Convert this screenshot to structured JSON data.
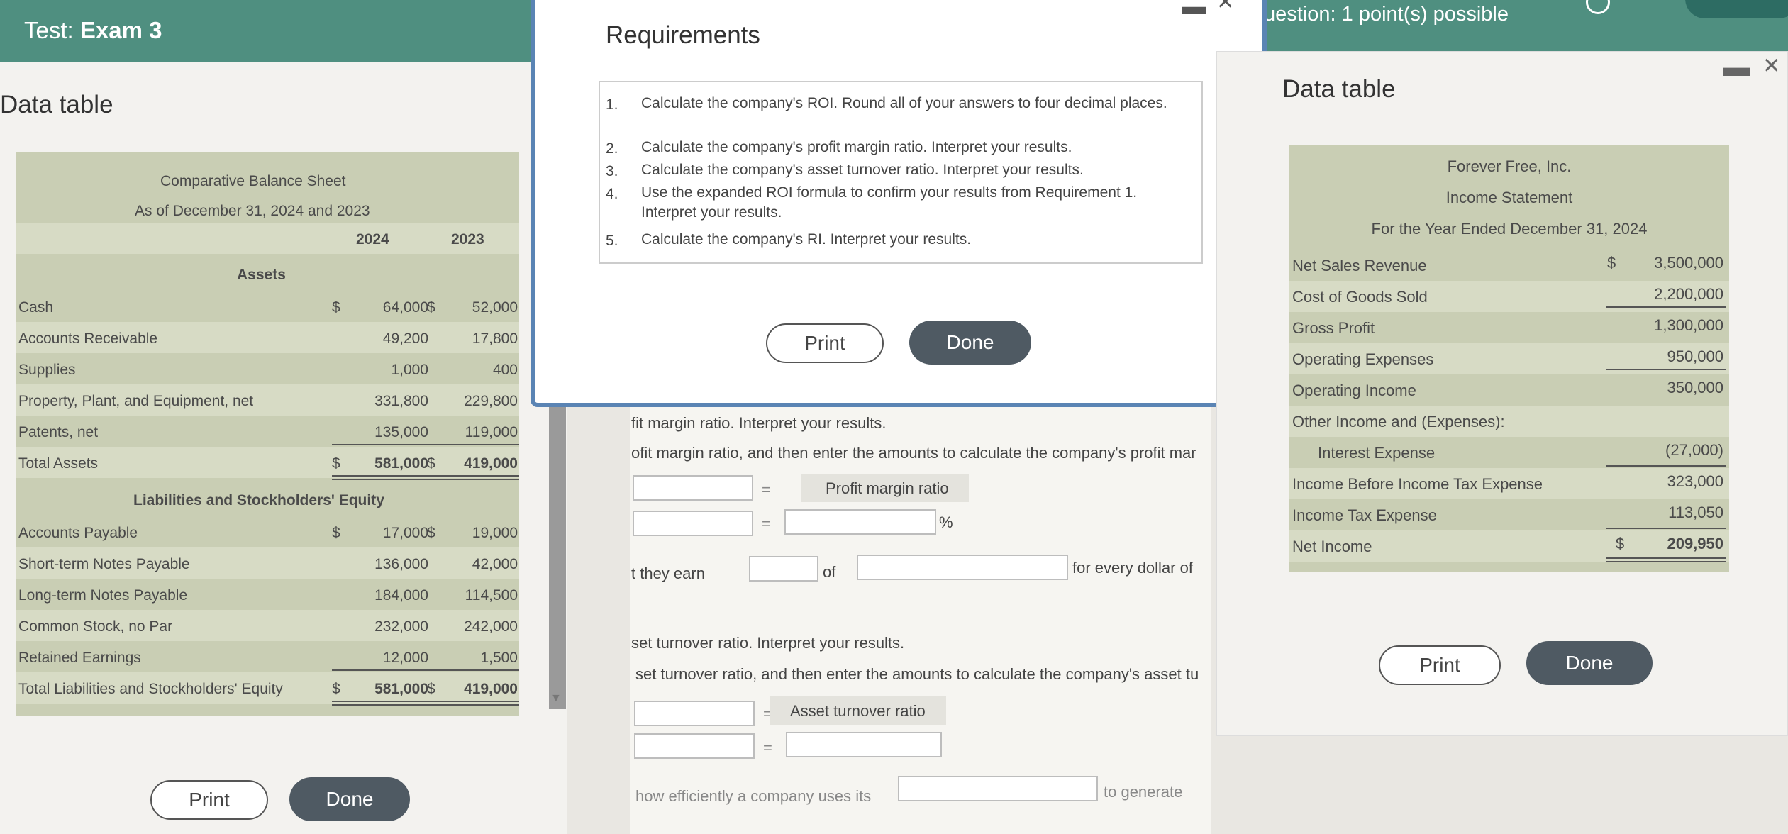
{
  "header": {
    "test_label": "Test:",
    "exam_name": "Exam 3",
    "question_info": "uestion: 1 point(s) possible"
  },
  "left_panel": {
    "title": "Data table",
    "balance_sheet": {
      "title": "Comparative Balance Sheet",
      "subtitle": "As of December 31, 2024 and 2023",
      "col1": "2024",
      "col2": "2023",
      "assets_header": "Assets",
      "liab_header": "Liabilities and Stockholders' Equity",
      "currency": "$",
      "rows": [
        {
          "label": "Cash",
          "v1": "64,000",
          "v2": "52,000"
        },
        {
          "label": "Accounts Receivable",
          "v1": "49,200",
          "v2": "17,800"
        },
        {
          "label": "Supplies",
          "v1": "1,000",
          "v2": "400"
        },
        {
          "label": "Property, Plant, and Equipment, net",
          "v1": "331,800",
          "v2": "229,800"
        },
        {
          "label": "Patents, net",
          "v1": "135,000",
          "v2": "119,000"
        },
        {
          "label": "Total Assets",
          "v1": "581,000",
          "v2": "419,000"
        },
        {
          "label": "Accounts Payable",
          "v1": "17,000",
          "v2": "19,000"
        },
        {
          "label": "Short-term Notes Payable",
          "v1": "136,000",
          "v2": "42,000"
        },
        {
          "label": "Long-term Notes Payable",
          "v1": "184,000",
          "v2": "114,500"
        },
        {
          "label": "Common Stock, no Par",
          "v1": "232,000",
          "v2": "242,000"
        },
        {
          "label": "Retained Earnings",
          "v1": "12,000",
          "v2": "1,500"
        },
        {
          "label": "Total Liabilities and Stockholders' Equity",
          "v1": "581,000",
          "v2": "419,000"
        }
      ]
    },
    "print_label": "Print",
    "done_label": "Done"
  },
  "requirements": {
    "title": "Requirements",
    "items": [
      {
        "num": "1.",
        "text": "Calculate the company's ROI. Round all of your answers to four decimal places."
      },
      {
        "num": "2.",
        "text": "Calculate the company's profit margin ratio. Interpret your results."
      },
      {
        "num": "3.",
        "text": "Calculate the company's asset turnover ratio. Interpret your results."
      },
      {
        "num": "4.",
        "text": "Use the expanded ROI formula to confirm your results from Requirement 1. Interpret your results."
      },
      {
        "num": "5.",
        "text": "Calculate the company's RI. Interpret your results."
      }
    ],
    "print_label": "Print",
    "done_label": "Done"
  },
  "question": {
    "line1": "fit margin ratio. Interpret your results.",
    "line2": "ofit margin ratio, and then enter the amounts to calculate the company's profit mar",
    "pm_label": "Profit margin ratio",
    "eq": "=",
    "pct": "%",
    "earn_prefix": "t they earn",
    "earn_of": "of",
    "earn_suffix": "for every dollar of",
    "line3": "set turnover ratio. Interpret your results.",
    "line4": "set turnover ratio, and then enter the amounts to calculate the company's asset tu",
    "at_label": "Asset turnover ratio",
    "line5_prefix": "how efficiently a company uses its",
    "line5_suffix": "to generate"
  },
  "right_panel": {
    "title": "Data table",
    "income_statement": {
      "company": "Forever Free, Inc.",
      "title": "Income Statement",
      "period": "For the Year Ended December 31, 2024",
      "currency": "$",
      "rows": [
        {
          "label": "Net Sales Revenue",
          "value": "3,500,000"
        },
        {
          "label": "Cost of Goods Sold",
          "value": "2,200,000"
        },
        {
          "label": "Gross Profit",
          "value": "1,300,000"
        },
        {
          "label": "Operating Expenses",
          "value": "950,000"
        },
        {
          "label": "Operating Income",
          "value": "350,000"
        },
        {
          "label": "Other Income and (Expenses):",
          "value": ""
        },
        {
          "label": "Interest Expense",
          "value": "(27,000)"
        },
        {
          "label": "Income Before Income Tax Expense",
          "value": "323,000"
        },
        {
          "label": "Income Tax Expense",
          "value": "113,050"
        },
        {
          "label": "Net Income",
          "value": "209,950"
        }
      ]
    },
    "print_label": "Print",
    "done_label": "Done"
  }
}
